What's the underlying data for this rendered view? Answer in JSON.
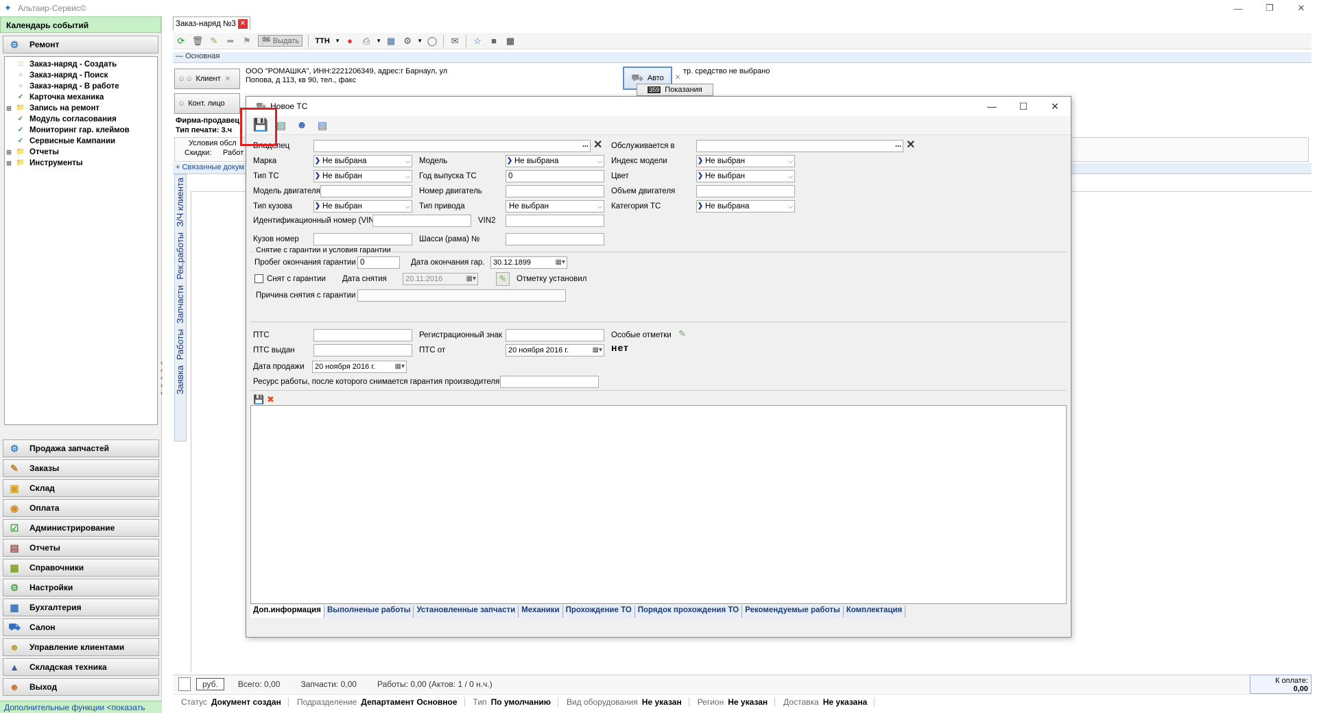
{
  "window": {
    "title": "Альтаир-Сервис©"
  },
  "left": {
    "calendar": "Календарь событий",
    "repair": "Ремонт",
    "tree": [
      {
        "label": "Заказ-наряд - Создать",
        "icon": "doc",
        "exp": ""
      },
      {
        "label": "Заказ-наряд - Поиск",
        "icon": "circle",
        "exp": ""
      },
      {
        "label": "Заказ-наряд - В работе",
        "icon": "circle",
        "exp": ""
      },
      {
        "label": "Карточка механика",
        "icon": "check",
        "exp": ""
      },
      {
        "label": "Запись на ремонт",
        "icon": "folder",
        "exp": "+"
      },
      {
        "label": "Модуль согласования",
        "icon": "check",
        "exp": ""
      },
      {
        "label": "Мониторинг гар. клеймов",
        "icon": "check",
        "exp": ""
      },
      {
        "label": "Сервисные Кампании",
        "icon": "check",
        "exp": ""
      },
      {
        "label": "Отчеты",
        "icon": "folder",
        "exp": "+"
      },
      {
        "label": "Инструменты",
        "icon": "folder",
        "exp": "+"
      }
    ],
    "nav": [
      {
        "label": "Продажа запчастей",
        "icon": "gears",
        "color": "#3a7fc0"
      },
      {
        "label": "Заказы",
        "icon": "pen",
        "color": "#c08030"
      },
      {
        "label": "Склад",
        "icon": "boxes",
        "color": "#d0a020"
      },
      {
        "label": "Оплата",
        "icon": "coin",
        "color": "#d09020"
      },
      {
        "label": "Администрирование",
        "icon": "admin",
        "color": "#40a040"
      },
      {
        "label": "Отчеты",
        "icon": "report",
        "color": "#c04040"
      },
      {
        "label": "Справочники",
        "icon": "books",
        "color": "#80a030"
      },
      {
        "label": "Настройки",
        "icon": "settings",
        "color": "#50a050"
      },
      {
        "label": "Бухгалтерия",
        "icon": "calc",
        "color": "#4070b0"
      },
      {
        "label": "Салон",
        "icon": "car",
        "color": "#3070c0"
      },
      {
        "label": "Управление клиентами",
        "icon": "clients",
        "color": "#c0a030"
      },
      {
        "label": "Складская техника",
        "icon": "forklift",
        "color": "#3060a0"
      },
      {
        "label": "Выход",
        "icon": "exit",
        "color": "#d07030"
      }
    ],
    "additional": "Дополнительные функции <показать"
  },
  "right": {
    "tab": "Заказ-наряд №3",
    "issue_btn": "Выдать",
    "ttn": "ТТН",
    "section": "Основная",
    "client_btn": "Клиент",
    "client_text": "ООО \"РОМАШКА\", ИНН:2221206349, адрес:г Барнаул, ул Попова, д 113, кв 90, тел., факс",
    "auto_btn": "Авто",
    "vehicle_text": "тр. средство не выбрано",
    "readings": "Показания",
    "readings_num": "359",
    "contact_btn": "Конт. лицо",
    "firm": "Фирма-продавец",
    "print_type": "Тип печати: 3.ч",
    "conditions": "Условия обсл",
    "discounts": "Скидки:",
    "works_short": "Работ",
    "linked_docs": "Связанные докум",
    "vtabs": [
      "Заявка",
      "Работы",
      "Запчасти",
      "Рек.работы",
      "З/Ч клиента"
    ],
    "status1": {
      "rub": "руб.",
      "total": "Всего: 0,00",
      "parts": "Запчасти: 0,00",
      "works": "Работы: 0,00 (Актов: 1 / 0 н.ч.)"
    },
    "topay_label": "К оплате:",
    "topay_val": "0,00",
    "status2": [
      {
        "label": "Статус",
        "value": "Документ создан"
      },
      {
        "label": "Подразделение",
        "value": "Департамент Основное"
      },
      {
        "label": "Тип",
        "value": "По умолчанию"
      },
      {
        "label": "Вид оборудования",
        "value": "Не указан"
      },
      {
        "label": "Регион",
        "value": "Не указан"
      },
      {
        "label": "Доставка",
        "value": "Не указана"
      }
    ]
  },
  "dialog": {
    "title": "Новое ТС",
    "owner": "Владелец",
    "served_in": "Обслуживается в",
    "brand": "Марка",
    "brand_val": "Не выбрана",
    "model": "Модель",
    "model_val": "Не выбрана",
    "model_index": "Индекс модели",
    "model_index_val": "Не выбран",
    "ts_type": "Тип ТС",
    "ts_type_val": "Не выбран",
    "year": "Год выпуска ТС",
    "year_val": "0",
    "color": "Цвет",
    "color_val": "Не выбран",
    "engine_model": "Модель двигателя",
    "engine_num": "Номер двигатель",
    "engine_vol": "Объем двигателя",
    "body_type": "Тип кузова",
    "body_type_val": "Не выбран",
    "drive_type": "Тип привода",
    "drive_type_val": "Не выбран",
    "category": "Категория ТС",
    "category_val": "Не выбрана",
    "vin": "Идентификационный номер (VIN)",
    "vin2": "VIN2",
    "body_num": "Кузов номер",
    "chassis": "Шасси (рама) №",
    "warranty_group": "Снятие с гарантии и условия гарантии",
    "warranty_mileage": "Пробег окончания гарантии",
    "warranty_mileage_val": "0",
    "warranty_end": "Дата окончания гар.",
    "warranty_end_val": "30.12.1899",
    "removed": "Снят с гарантии",
    "removal_date": "Дата снятия",
    "removal_date_val": "20.11.2016",
    "mark_set": "Отметку установил",
    "removal_reason": "Причина снятия с гарантии",
    "pts": "ПТС",
    "reg_sign": "Регистрационный знак",
    "special": "Особые отметки",
    "special_val": "нет",
    "pts_issued": "ПТС выдан",
    "pts_from": "ПТС от",
    "pts_from_val": "20  ноября   2016 г.",
    "sale_date": "Дата продажи",
    "sale_date_val": "20  ноября   2016 г.",
    "resource": "Ресурс работы, после которого снимается гарантия производителя",
    "tabs": [
      "Доп.информация",
      "Выполненые работы",
      "Установленные запчасти",
      "Механики",
      "Прохождение ТО",
      "Порядок прохождения ТО",
      "Рекомендуемые работы",
      "Комплектация"
    ]
  }
}
